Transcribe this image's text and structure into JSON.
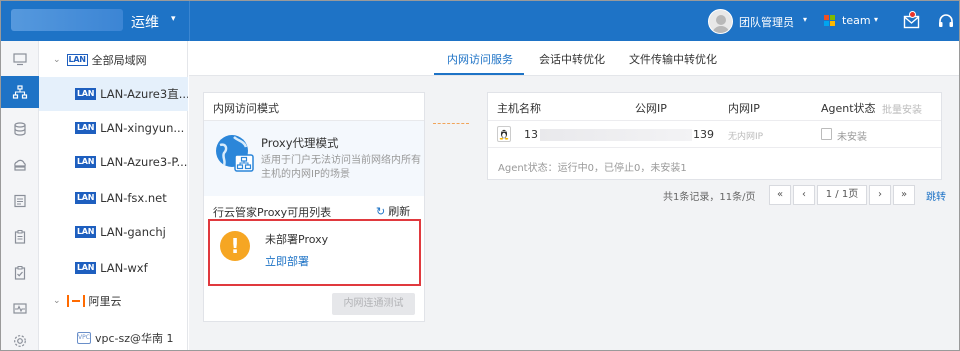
{
  "header": {
    "product_title": "运维",
    "user_name": "团队管理员",
    "team_name": "team"
  },
  "rail": {
    "items": [
      {
        "icon": "monitor-icon"
      },
      {
        "icon": "network-topology-icon",
        "active": true
      },
      {
        "icon": "database-icon"
      },
      {
        "icon": "cloud-server-icon"
      },
      {
        "icon": "file-list-icon"
      },
      {
        "icon": "clipboard-icon"
      },
      {
        "icon": "checklist-icon"
      },
      {
        "icon": "pulse-monitor-icon"
      },
      {
        "icon": "settings-icon"
      }
    ]
  },
  "tree": {
    "root_label": "全部局域网",
    "items": [
      {
        "badge": "LAN",
        "label": "LAN-Azure3直...",
        "active": true
      },
      {
        "badge": "LAN",
        "label": "LAN-xingyun..."
      },
      {
        "badge": "LAN",
        "label": "LAN-Azure3-P..."
      },
      {
        "badge": "LAN",
        "label": "LAN-fsx.net"
      },
      {
        "badge": "LAN",
        "label": "LAN-ganchj"
      },
      {
        "badge": "LAN",
        "label": "LAN-wxf"
      }
    ],
    "cloud_label": "阿里云",
    "vpc_badge": "VPC",
    "vpc_label": "vpc-sz@华南 1"
  },
  "tabs": [
    {
      "label": "内网访问服务",
      "active": true
    },
    {
      "label": "会话中转优化"
    },
    {
      "label": "文件传输中转优化"
    }
  ],
  "mode_panel": {
    "title": "内网访问模式",
    "mode_name": "Proxy代理模式",
    "mode_desc": "适用于门户无法访问当前网络内所有主机的内网IP的场景",
    "proxy_list_title": "行云管家Proxy可用列表",
    "refresh_label": "刷新",
    "alert_title": "未部署Proxy",
    "deploy_link": "立即部署",
    "test_button": "内网连通测试"
  },
  "host_table": {
    "columns": [
      "主机名称",
      "公网IP",
      "内网IP",
      "Agent状态",
      "批量安装"
    ],
    "rows": [
      {
        "host_prefix": "13",
        "public_ip_suffix": "139",
        "lan_ip": "无内网IP",
        "agent_status": "未安装"
      }
    ],
    "summary": "Agent状态：运行中0，已停止0，未安装1"
  },
  "pagination": {
    "info": "共1条记录，11条/页",
    "first": "«",
    "prev": "‹",
    "current": "1 / 1页",
    "next": "›",
    "last": "»",
    "jump": "跳转"
  },
  "colors": {
    "brand_blue": "#1e73c6",
    "alert_red": "#e0393e",
    "warning_orange": "#f6a623",
    "aliyun_orange": "#ff6a00"
  }
}
